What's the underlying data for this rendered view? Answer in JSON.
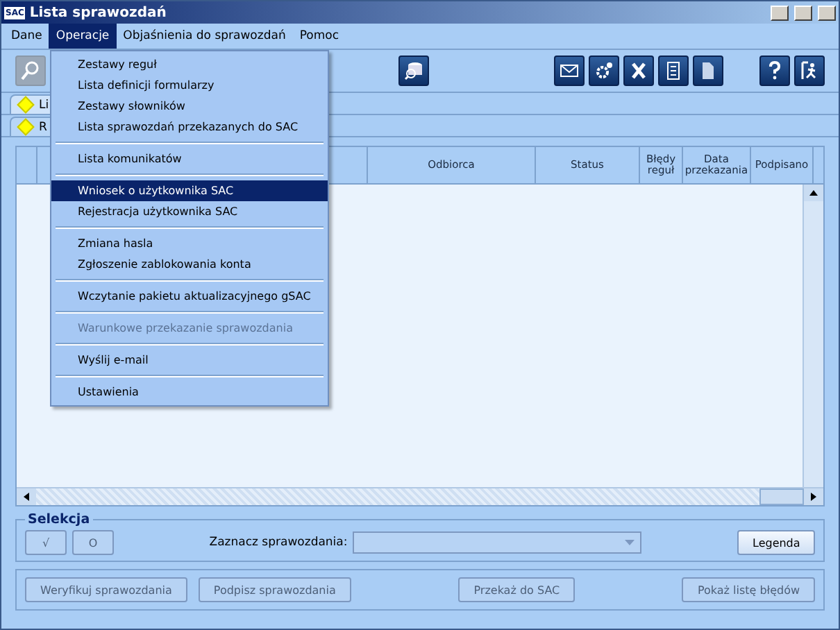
{
  "window": {
    "title": "Lista sprawozdań",
    "icon_text": "SAC"
  },
  "menu_bar": [
    {
      "label": "Dane",
      "selected": false
    },
    {
      "label": "Operacje",
      "selected": true
    },
    {
      "label": "Objaśnienia do sprawozdań",
      "selected": false
    },
    {
      "label": "Pomoc",
      "selected": false
    }
  ],
  "dropdown": [
    {
      "kind": "item",
      "label": "Zestawy reguł",
      "selected": false,
      "disabled": false
    },
    {
      "kind": "item",
      "label": "Lista definicji formularzy",
      "selected": false,
      "disabled": false
    },
    {
      "kind": "item",
      "label": "Zestawy słowników",
      "selected": false,
      "disabled": false
    },
    {
      "kind": "item",
      "label": "Lista sprawozdań przekazanych do SAC",
      "selected": false,
      "disabled": false
    },
    {
      "kind": "separator"
    },
    {
      "kind": "item",
      "label": "Lista komunikatów",
      "selected": false,
      "disabled": false
    },
    {
      "kind": "separator"
    },
    {
      "kind": "item",
      "label": "Wniosek o użytkownika SAC",
      "selected": true,
      "disabled": false
    },
    {
      "kind": "item",
      "label": "Rejestracja użytkownika SAC",
      "selected": false,
      "disabled": false
    },
    {
      "kind": "separator"
    },
    {
      "kind": "item",
      "label": "Zmiana hasla",
      "selected": false,
      "disabled": false
    },
    {
      "kind": "item",
      "label": "Zgłoszenie zablokowania konta",
      "selected": false,
      "disabled": false
    },
    {
      "kind": "separator"
    },
    {
      "kind": "item",
      "label": "Wczytanie pakietu aktualizacyjnego gSAC",
      "selected": false,
      "disabled": false
    },
    {
      "kind": "separator"
    },
    {
      "kind": "item",
      "label": "Warunkowe przekazanie sprawozdania",
      "selected": false,
      "disabled": true
    },
    {
      "kind": "separator"
    },
    {
      "kind": "item",
      "label": "Wyślij e-mail",
      "selected": false,
      "disabled": false
    },
    {
      "kind": "separator"
    },
    {
      "kind": "item",
      "label": "Ustawienia",
      "selected": false,
      "disabled": false
    }
  ],
  "tabs": [
    {
      "label": "Li",
      "selected": true
    },
    {
      "label": "R",
      "selected": false
    }
  ],
  "table": {
    "columns": [
      "Odbiorca",
      "Status",
      "Błędy reguł",
      "Data przekazania",
      "Podpisano"
    ]
  },
  "selection": {
    "title": "Selekcja",
    "buttons": [
      {
        "label": "√",
        "disabled": true
      },
      {
        "label": "O",
        "disabled": true
      }
    ],
    "filter_label": "Zaznacz sprawozdania:",
    "legend_button": "Legenda"
  },
  "actions": [
    {
      "label": "Weryfikuj sprawozdania",
      "disabled": true
    },
    {
      "label": "Podpisz sprawozdania",
      "disabled": true
    },
    {
      "label": "Przekaż do SAC",
      "disabled": true
    },
    {
      "label": "Pokaż listę błędów",
      "disabled": true
    }
  ]
}
